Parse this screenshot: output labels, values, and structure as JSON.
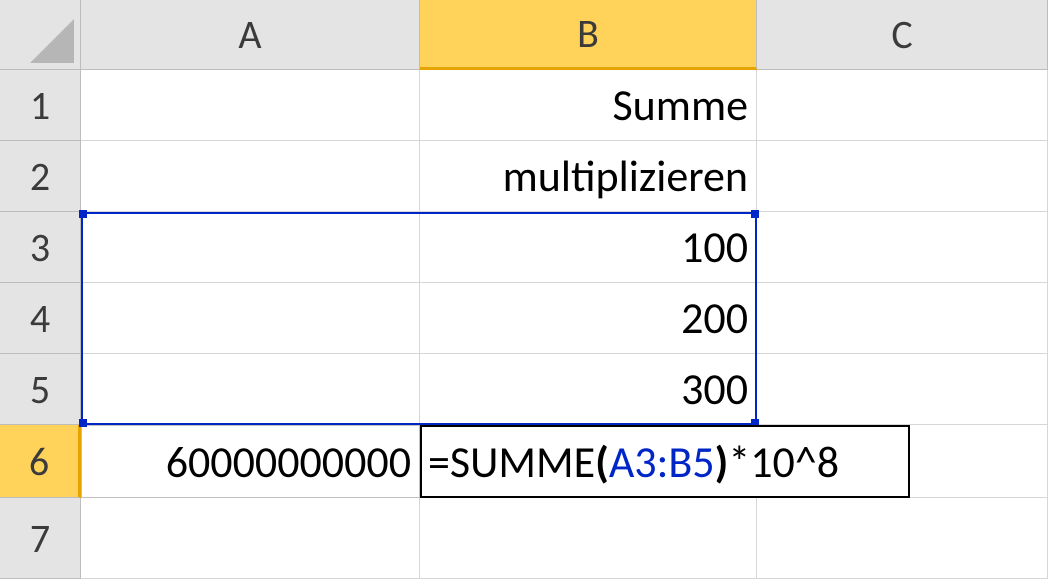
{
  "columns": {
    "A": "A",
    "B": "B",
    "C": "C"
  },
  "rows": {
    "r1": "1",
    "r2": "2",
    "r3": "3",
    "r4": "4",
    "r5": "5",
    "r6": "6",
    "r7": "7"
  },
  "cells": {
    "B1": "Summe",
    "B2": "multiplizieren",
    "B3": "100",
    "B4": "200",
    "B5": "300",
    "A6": "60000000000"
  },
  "formula": {
    "eq": "=",
    "fn": "SUMME",
    "open": "(",
    "ref": "A3:B5",
    "close": ")",
    "tail": "*10^8"
  },
  "selected_range": "A3:B5",
  "active_cell": "B6"
}
